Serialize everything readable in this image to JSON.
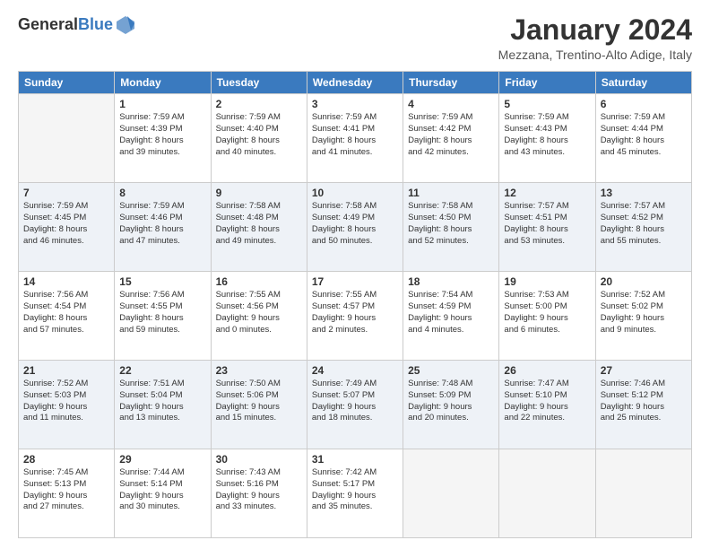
{
  "logo": {
    "general": "General",
    "blue": "Blue"
  },
  "title": "January 2024",
  "location": "Mezzana, Trentino-Alto Adige, Italy",
  "headers": [
    "Sunday",
    "Monday",
    "Tuesday",
    "Wednesday",
    "Thursday",
    "Friday",
    "Saturday"
  ],
  "weeks": [
    [
      {
        "day": "",
        "info": ""
      },
      {
        "day": "1",
        "info": "Sunrise: 7:59 AM\nSunset: 4:39 PM\nDaylight: 8 hours\nand 39 minutes."
      },
      {
        "day": "2",
        "info": "Sunrise: 7:59 AM\nSunset: 4:40 PM\nDaylight: 8 hours\nand 40 minutes."
      },
      {
        "day": "3",
        "info": "Sunrise: 7:59 AM\nSunset: 4:41 PM\nDaylight: 8 hours\nand 41 minutes."
      },
      {
        "day": "4",
        "info": "Sunrise: 7:59 AM\nSunset: 4:42 PM\nDaylight: 8 hours\nand 42 minutes."
      },
      {
        "day": "5",
        "info": "Sunrise: 7:59 AM\nSunset: 4:43 PM\nDaylight: 8 hours\nand 43 minutes."
      },
      {
        "day": "6",
        "info": "Sunrise: 7:59 AM\nSunset: 4:44 PM\nDaylight: 8 hours\nand 45 minutes."
      }
    ],
    [
      {
        "day": "7",
        "info": "Sunrise: 7:59 AM\nSunset: 4:45 PM\nDaylight: 8 hours\nand 46 minutes."
      },
      {
        "day": "8",
        "info": "Sunrise: 7:59 AM\nSunset: 4:46 PM\nDaylight: 8 hours\nand 47 minutes."
      },
      {
        "day": "9",
        "info": "Sunrise: 7:58 AM\nSunset: 4:48 PM\nDaylight: 8 hours\nand 49 minutes."
      },
      {
        "day": "10",
        "info": "Sunrise: 7:58 AM\nSunset: 4:49 PM\nDaylight: 8 hours\nand 50 minutes."
      },
      {
        "day": "11",
        "info": "Sunrise: 7:58 AM\nSunset: 4:50 PM\nDaylight: 8 hours\nand 52 minutes."
      },
      {
        "day": "12",
        "info": "Sunrise: 7:57 AM\nSunset: 4:51 PM\nDaylight: 8 hours\nand 53 minutes."
      },
      {
        "day": "13",
        "info": "Sunrise: 7:57 AM\nSunset: 4:52 PM\nDaylight: 8 hours\nand 55 minutes."
      }
    ],
    [
      {
        "day": "14",
        "info": "Sunrise: 7:56 AM\nSunset: 4:54 PM\nDaylight: 8 hours\nand 57 minutes."
      },
      {
        "day": "15",
        "info": "Sunrise: 7:56 AM\nSunset: 4:55 PM\nDaylight: 8 hours\nand 59 minutes."
      },
      {
        "day": "16",
        "info": "Sunrise: 7:55 AM\nSunset: 4:56 PM\nDaylight: 9 hours\nand 0 minutes."
      },
      {
        "day": "17",
        "info": "Sunrise: 7:55 AM\nSunset: 4:57 PM\nDaylight: 9 hours\nand 2 minutes."
      },
      {
        "day": "18",
        "info": "Sunrise: 7:54 AM\nSunset: 4:59 PM\nDaylight: 9 hours\nand 4 minutes."
      },
      {
        "day": "19",
        "info": "Sunrise: 7:53 AM\nSunset: 5:00 PM\nDaylight: 9 hours\nand 6 minutes."
      },
      {
        "day": "20",
        "info": "Sunrise: 7:52 AM\nSunset: 5:02 PM\nDaylight: 9 hours\nand 9 minutes."
      }
    ],
    [
      {
        "day": "21",
        "info": "Sunrise: 7:52 AM\nSunset: 5:03 PM\nDaylight: 9 hours\nand 11 minutes."
      },
      {
        "day": "22",
        "info": "Sunrise: 7:51 AM\nSunset: 5:04 PM\nDaylight: 9 hours\nand 13 minutes."
      },
      {
        "day": "23",
        "info": "Sunrise: 7:50 AM\nSunset: 5:06 PM\nDaylight: 9 hours\nand 15 minutes."
      },
      {
        "day": "24",
        "info": "Sunrise: 7:49 AM\nSunset: 5:07 PM\nDaylight: 9 hours\nand 18 minutes."
      },
      {
        "day": "25",
        "info": "Sunrise: 7:48 AM\nSunset: 5:09 PM\nDaylight: 9 hours\nand 20 minutes."
      },
      {
        "day": "26",
        "info": "Sunrise: 7:47 AM\nSunset: 5:10 PM\nDaylight: 9 hours\nand 22 minutes."
      },
      {
        "day": "27",
        "info": "Sunrise: 7:46 AM\nSunset: 5:12 PM\nDaylight: 9 hours\nand 25 minutes."
      }
    ],
    [
      {
        "day": "28",
        "info": "Sunrise: 7:45 AM\nSunset: 5:13 PM\nDaylight: 9 hours\nand 27 minutes."
      },
      {
        "day": "29",
        "info": "Sunrise: 7:44 AM\nSunset: 5:14 PM\nDaylight: 9 hours\nand 30 minutes."
      },
      {
        "day": "30",
        "info": "Sunrise: 7:43 AM\nSunset: 5:16 PM\nDaylight: 9 hours\nand 33 minutes."
      },
      {
        "day": "31",
        "info": "Sunrise: 7:42 AM\nSunset: 5:17 PM\nDaylight: 9 hours\nand 35 minutes."
      },
      {
        "day": "",
        "info": ""
      },
      {
        "day": "",
        "info": ""
      },
      {
        "day": "",
        "info": ""
      }
    ]
  ]
}
